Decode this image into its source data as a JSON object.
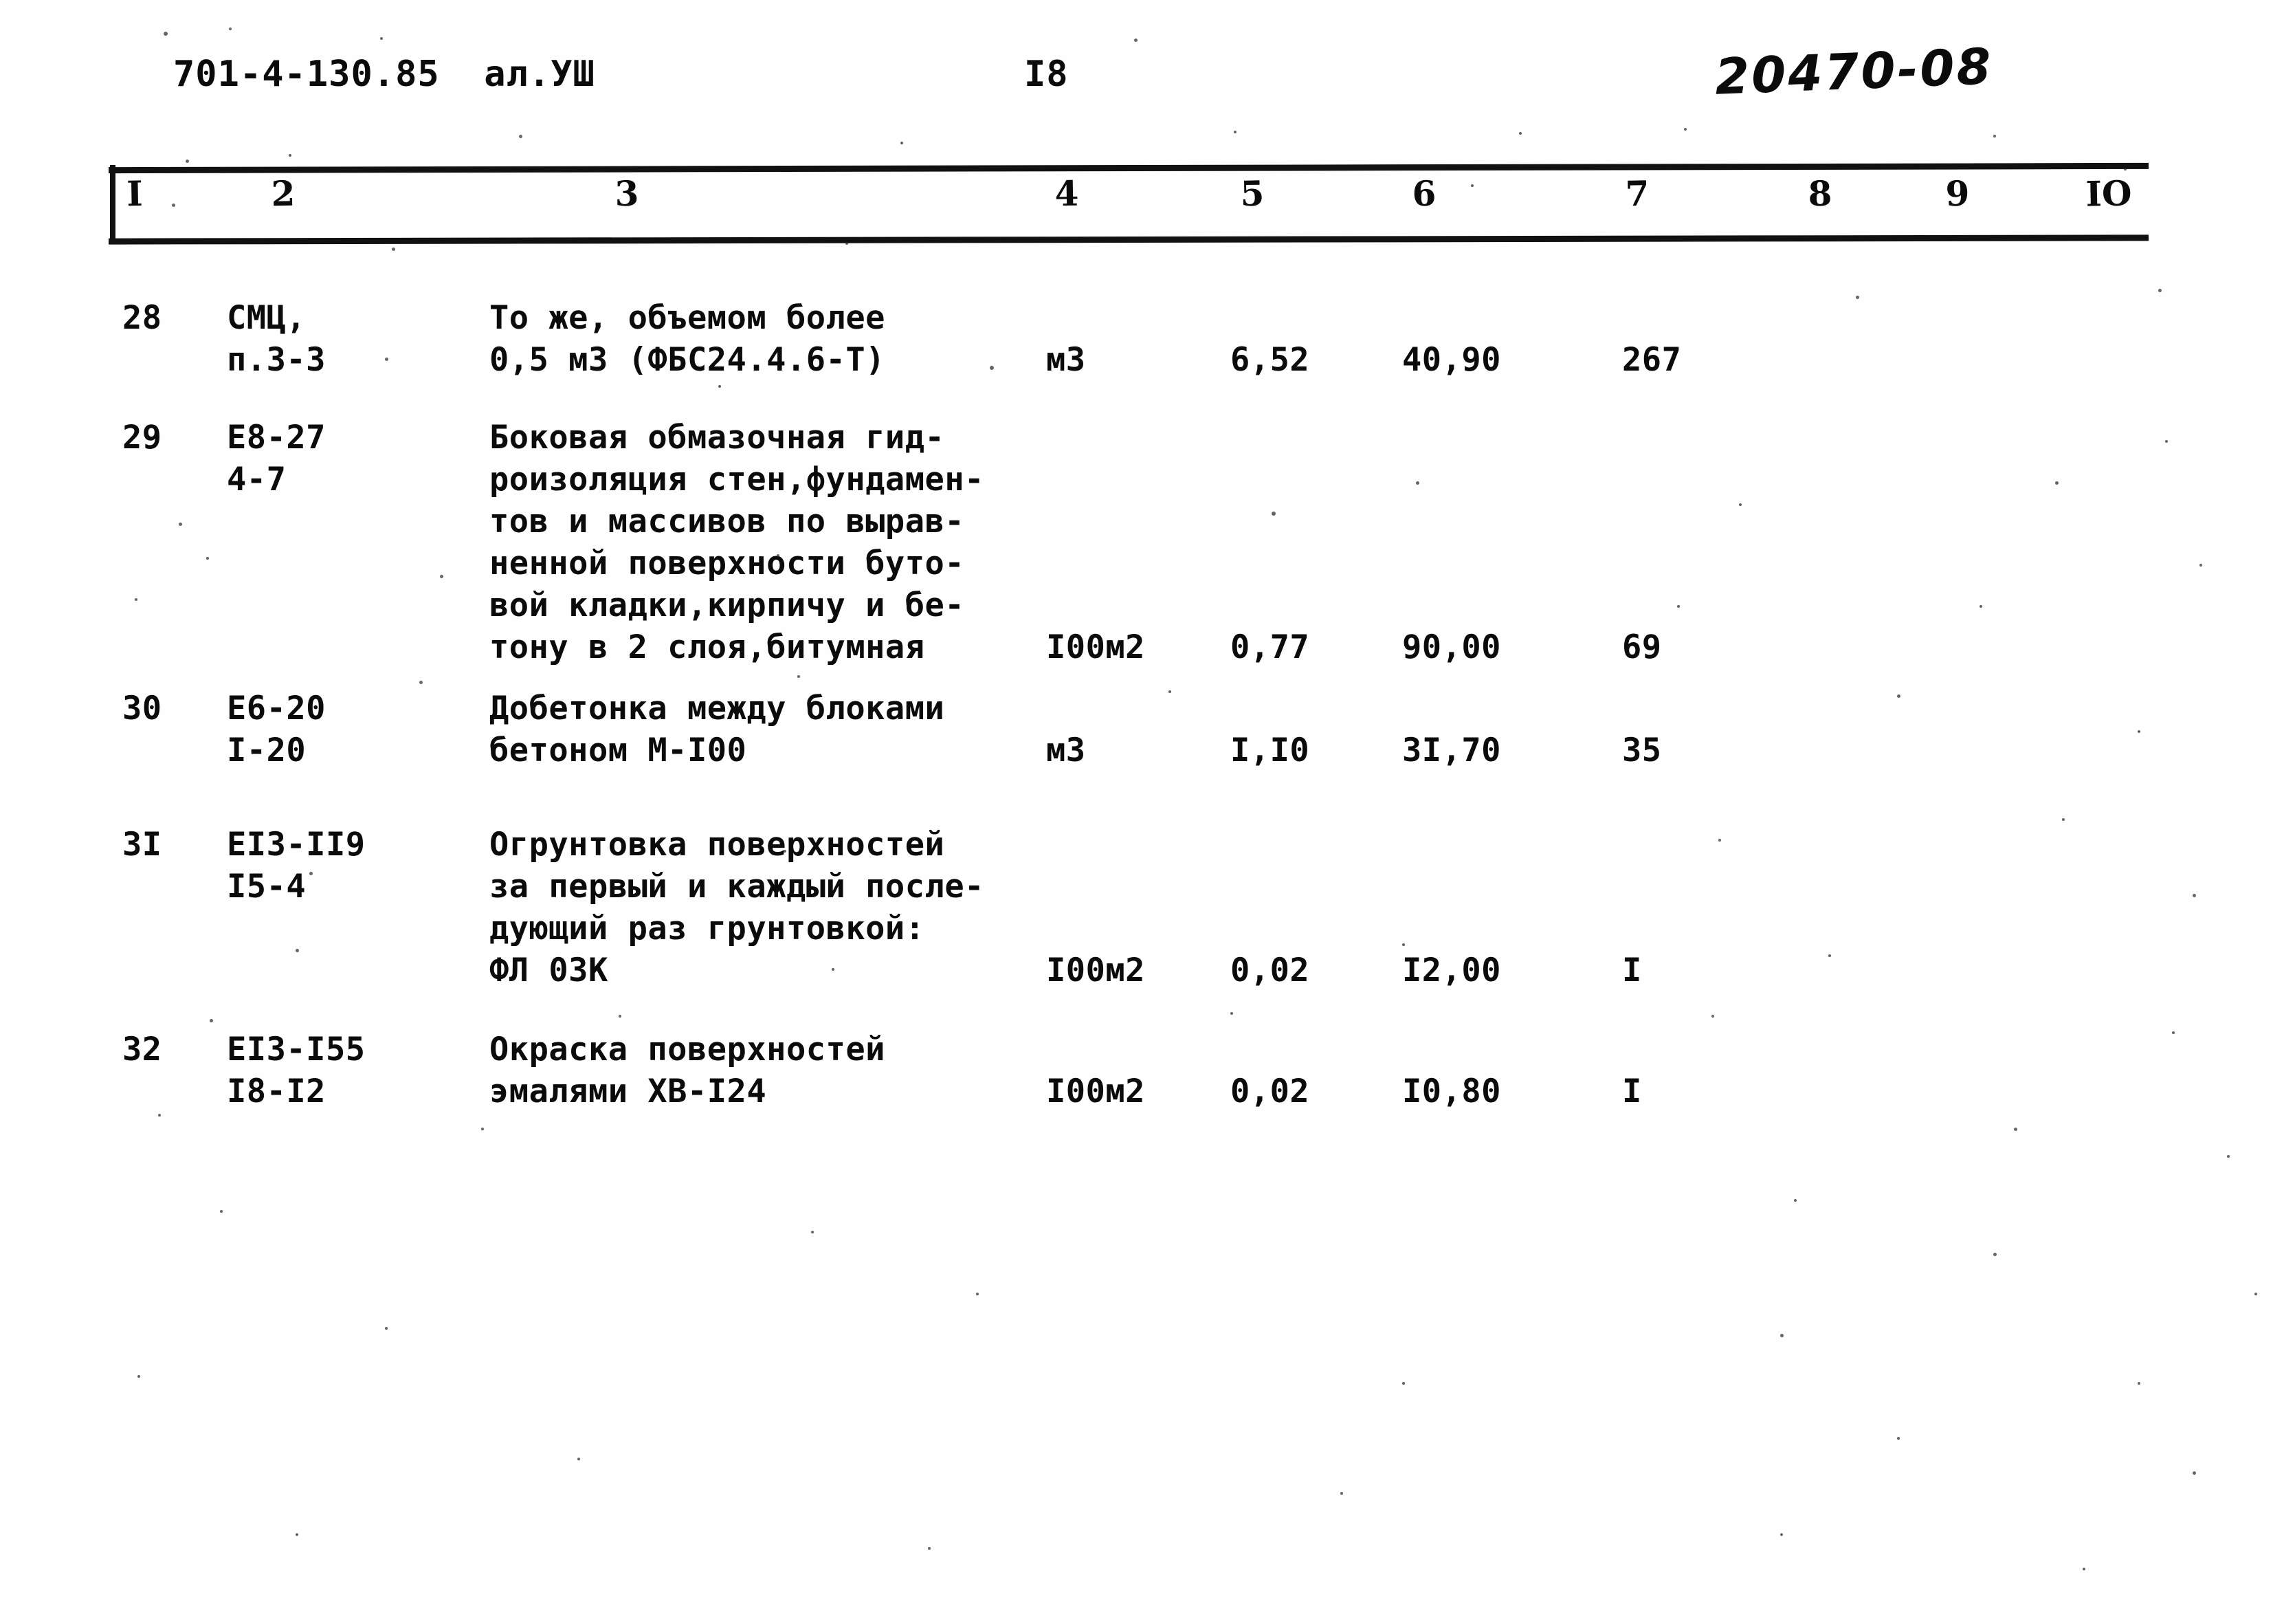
{
  "document": {
    "header": {
      "code": "701-4-130.85  ал.УШ",
      "page_number": "I8",
      "stamp": "20470-08"
    }
  },
  "table": {
    "column_numbers": [
      "I",
      "2",
      "3",
      "4",
      "5",
      "6",
      "7",
      "8",
      "9",
      "IO"
    ],
    "rows": [
      {
        "num": "28",
        "code": "СМЦ,\nп.3-3",
        "description": "То же, объемом более\n0,5 м3 (ФБС24.4.6-Т)",
        "unit": "м3",
        "qty": "6,52",
        "price": "40,90",
        "total": "267",
        "col8": "",
        "col9": "",
        "col10": ""
      },
      {
        "num": "29",
        "code": "Е8-27\n4-7",
        "description": "Боковая обмазочная гид-\nроизоляция стен,фундамен-\nтов и массивов по вырав-\nненной поверхности буто-\nвой кладки,кирпичу и бе-\nтону в 2 слоя,битумная",
        "unit": "I00м2",
        "qty": "0,77",
        "price": "90,00",
        "total": "69",
        "col8": "",
        "col9": "",
        "col10": ""
      },
      {
        "num": "30",
        "code": "Е6-20\nI-20",
        "description": "Добетонка между блоками\nбетоном М-I00",
        "unit": "м3",
        "qty": "I,I0",
        "price": "3I,70",
        "total": "35",
        "col8": "",
        "col9": "",
        "col10": ""
      },
      {
        "num": "3I",
        "code": "ЕI3-II9\nI5-4",
        "description": "Огрунтовка поверхностей\nза первый и каждый после-\nдующий раз грунтовкой:\nФЛ 03К",
        "unit": "I00м2",
        "qty": "0,02",
        "price": "I2,00",
        "total": "I",
        "col8": "",
        "col9": "",
        "col10": ""
      },
      {
        "num": "32",
        "code": "ЕI3-I55\nI8-I2",
        "description": "Окраска поверхностей\nэмалями ХВ-I24",
        "unit": "I00м2",
        "qty": "0,02",
        "price": "I0,80",
        "total": "I",
        "col8": "",
        "col9": "",
        "col10": ""
      }
    ]
  }
}
